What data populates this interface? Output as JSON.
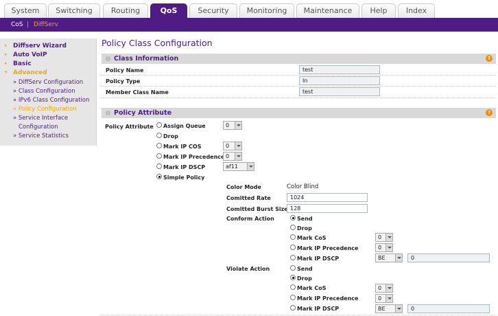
{
  "topnav": {
    "tabs": [
      "System",
      "Switching",
      "Routing",
      "QoS",
      "Security",
      "Monitoring",
      "Maintenance",
      "Help",
      "Index"
    ],
    "active": "QoS"
  },
  "subnav": {
    "items": [
      "CoS",
      "DiffServ"
    ],
    "separator": "|",
    "active": "DiffServ"
  },
  "sidebar": {
    "items": [
      "Diffserv Wizard",
      "Auto VoIP",
      "Basic",
      "Advanced"
    ],
    "sub": [
      "» DiffServ Configuration",
      "» Class Configuration",
      "» IPv6 Class Configuration",
      "» Policy Configuration",
      "» Service Interface",
      "Configuration",
      "» Service Statistics"
    ],
    "current": "» Policy Configuration"
  },
  "page": {
    "title": "Policy Class Configuration",
    "class_info": {
      "header": "Class Information",
      "policy_name_label": "Policy Name",
      "policy_name": "test",
      "policy_type_label": "Policy Type",
      "policy_type": "In",
      "member_class_label": "Member Class Name",
      "member_class": "test"
    },
    "policy_attr": {
      "header": "Policy Attribute",
      "label": "Policy Attribute",
      "options": {
        "assign_queue": "Assign Queue",
        "assign_queue_val": "0",
        "drop": "Drop",
        "mark_ip_cos": "Mark IP COS",
        "mark_ip_cos_val": "0",
        "mark_ip_prec": "Mark IP Precedence",
        "mark_ip_prec_val": "0",
        "mark_ip_dscp": "Mark IP DSCP",
        "mark_ip_dscp_val": "af11",
        "simple_policy": "Simple Policy"
      },
      "selected": "Simple Policy",
      "simple": {
        "color_mode_label": "Color Mode",
        "color_mode": "Color Blind",
        "committed_rate_label": "Comitted Rate",
        "committed_rate": "1024",
        "committed_burst_label": "Comitted Burst Size",
        "committed_burst": "128",
        "conform_label": "Conform Action",
        "violate_label": "Violate Action",
        "actions": {
          "send": "Send",
          "drop": "Drop",
          "mark_cos": "Mark CoS",
          "mark_prec": "Mark IP Precedence",
          "mark_dscp": "Mark IP DSCP"
        },
        "conform": {
          "selected": "Send",
          "cos_val": "0",
          "prec_val": "0",
          "dscp_val": "BE",
          "dscp_text": "0"
        },
        "violate": {
          "selected": "Drop",
          "cos_val": "0",
          "prec_val": "0",
          "dscp_val": "BE",
          "dscp_text": "0"
        }
      }
    }
  },
  "colors": {
    "brand_purple": "#4f1c85",
    "accent_orange": "#f7a800",
    "help_orange": "#f28c00"
  }
}
